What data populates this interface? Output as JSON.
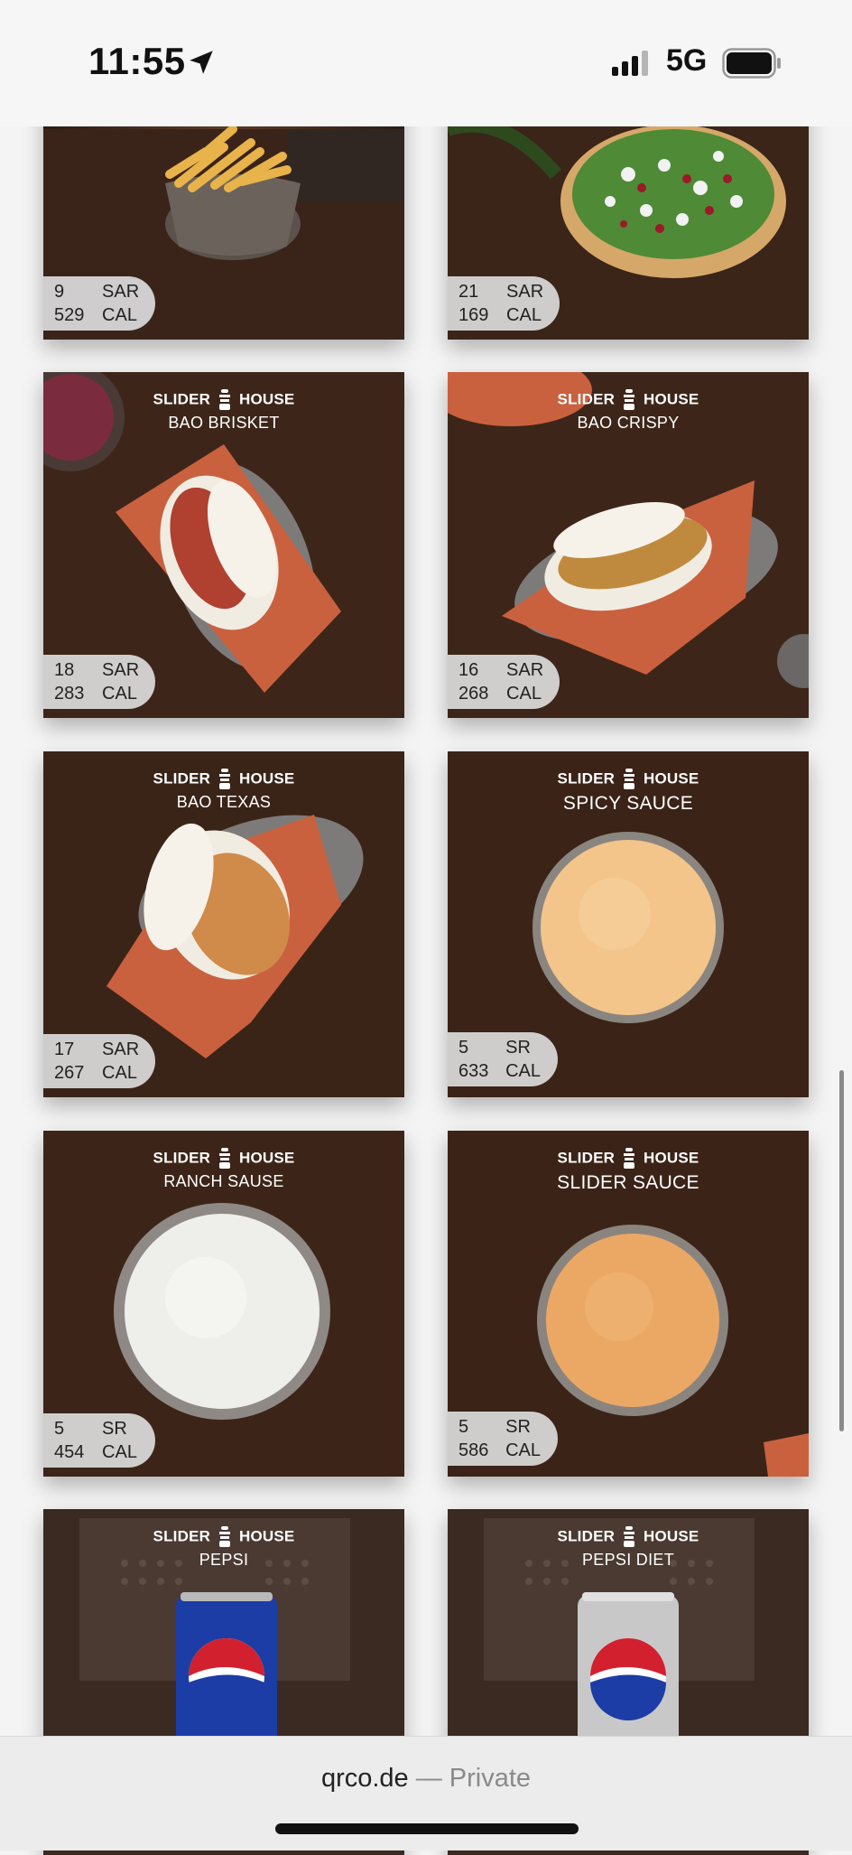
{
  "status_bar": {
    "time": "11:55",
    "network": "5G"
  },
  "brand": {
    "left": "SLIDER",
    "right": "HOUSE"
  },
  "items": [
    {
      "name": "",
      "price": "9",
      "price_unit": "SAR",
      "cal": "529",
      "cal_unit": "CAL"
    },
    {
      "name": "",
      "price": "21",
      "price_unit": "SAR",
      "cal": "169",
      "cal_unit": "CAL"
    },
    {
      "name": "BAO BRISKET",
      "price": "18",
      "price_unit": "SAR",
      "cal": "283",
      "cal_unit": "CAL"
    },
    {
      "name": "BAO CRISPY",
      "price": "16",
      "price_unit": "SAR",
      "cal": "268",
      "cal_unit": "CAL"
    },
    {
      "name": "BAO TEXAS",
      "price": "17",
      "price_unit": "SAR",
      "cal": "267",
      "cal_unit": "CAL"
    },
    {
      "name": "SPICY SAUCE",
      "price": "5",
      "price_unit": "SR",
      "cal": "633",
      "cal_unit": "CAL"
    },
    {
      "name": "RANCH SAUSE",
      "price": "5",
      "price_unit": "SR",
      "cal": "454",
      "cal_unit": "CAL"
    },
    {
      "name": "SLIDER SAUCE",
      "price": "5",
      "price_unit": "SR",
      "cal": "586",
      "cal_unit": "CAL"
    },
    {
      "name": "PEPSI",
      "price": "",
      "price_unit": "",
      "cal": "",
      "cal_unit": ""
    },
    {
      "name": "PEPSI DIET",
      "price": "",
      "price_unit": "",
      "cal": "",
      "cal_unit": ""
    }
  ],
  "bottom_bar": {
    "domain": "qrco.de",
    "separator": " — ",
    "label": "Private"
  }
}
